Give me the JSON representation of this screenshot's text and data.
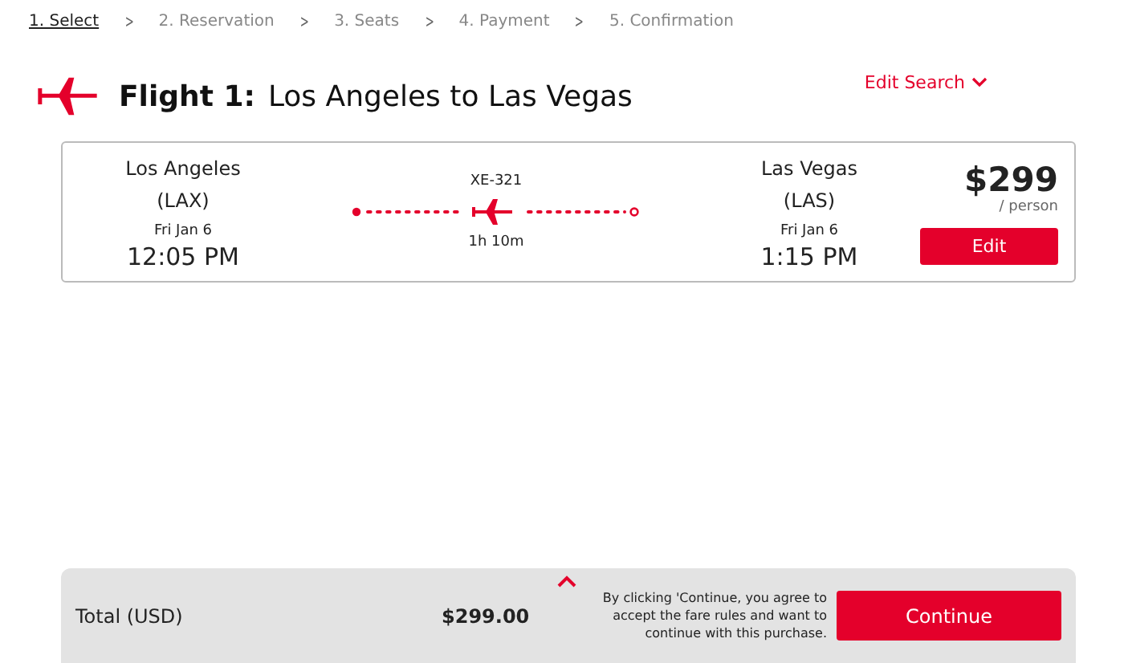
{
  "steps": [
    {
      "label": "1. Select",
      "selected": true
    },
    {
      "label": "2. Reservation",
      "selected": false
    },
    {
      "label": "3. Seats",
      "selected": false
    },
    {
      "label": "4. Payment",
      "selected": false
    },
    {
      "label": "5. Confirmation",
      "selected": false
    }
  ],
  "separator": ">",
  "header": {
    "flight": "Flight 1:",
    "route": "Los Angeles to Las Vegas",
    "edit_search": "Edit Search"
  },
  "flight_card": {
    "origin": {
      "city": "Los Angeles",
      "code": "(LAX)",
      "date": "Fri Jan 6",
      "time": "12:05 PM"
    },
    "flight_number": "XE-321",
    "duration": "1h 10m",
    "destination": {
      "city": "Las Vegas",
      "code": "(LAS)",
      "date": "Fri Jan 6",
      "time": "1:15 PM"
    },
    "price": "$299",
    "per": "/ person",
    "edit_button": "Edit"
  },
  "footer": {
    "total_label": "Total (USD)",
    "total": "$299.00",
    "notice": "By clicking 'Continue, you agree to accept the fare rules and want to continue with this purchase.",
    "continue_button": "Continue"
  }
}
